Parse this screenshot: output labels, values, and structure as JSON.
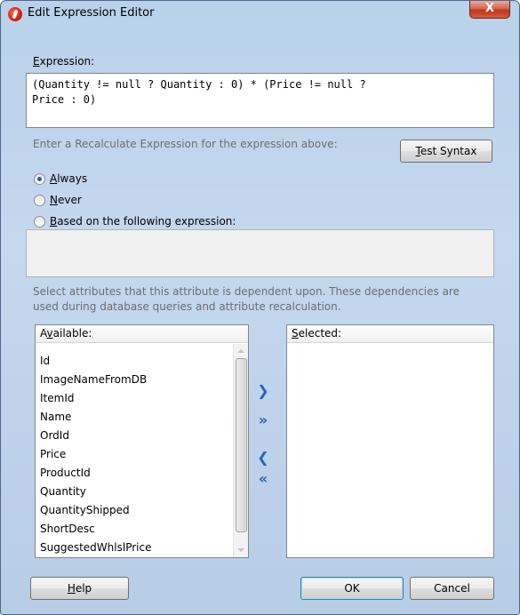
{
  "window": {
    "title": "Edit Expression Editor",
    "close_label": "X"
  },
  "expression": {
    "label_prefix": "E",
    "label_rest": "xpression:",
    "value": "(Quantity != null ? Quantity : 0) * (Price != null ?\nPrice : 0)"
  },
  "recalc": {
    "hint": "Enter a Recalculate Expression for the expression above:",
    "test_syntax_prefix": "T",
    "test_syntax_rest": "est Syntax",
    "options": [
      {
        "prefix": "A",
        "rest": "lways",
        "checked": true
      },
      {
        "prefix": "N",
        "rest": "ever",
        "checked": false
      },
      {
        "prefix": "B",
        "rest": "ased on the following expression:",
        "checked": false
      }
    ]
  },
  "dependencies": {
    "hint_line1": "Select attributes that this attribute is dependent upon. These dependencies are",
    "hint_line2": "used during database queries and attribute recalculation.",
    "available_prefix": "A",
    "available_u": "v",
    "available_rest": "ailable:",
    "selected_prefix": "S",
    "selected_rest": "elected:",
    "available_items": [
      "Id",
      "ImageNameFromDB",
      "ItemId",
      "Name",
      "OrdId",
      "Price",
      "ProductId",
      "Quantity",
      "QuantityShipped",
      "ShortDesc",
      "SuggestedWhlslPrice"
    ],
    "move_buttons": [
      ">",
      ">>",
      "<",
      "<<"
    ]
  },
  "footer": {
    "help_prefix": "H",
    "help_rest": "elp",
    "ok_label": "OK",
    "cancel_label": "Cancel"
  },
  "colors": {
    "frame": "#b9d1ea",
    "close": "#c2351a",
    "arrow": "#2a62b8"
  }
}
